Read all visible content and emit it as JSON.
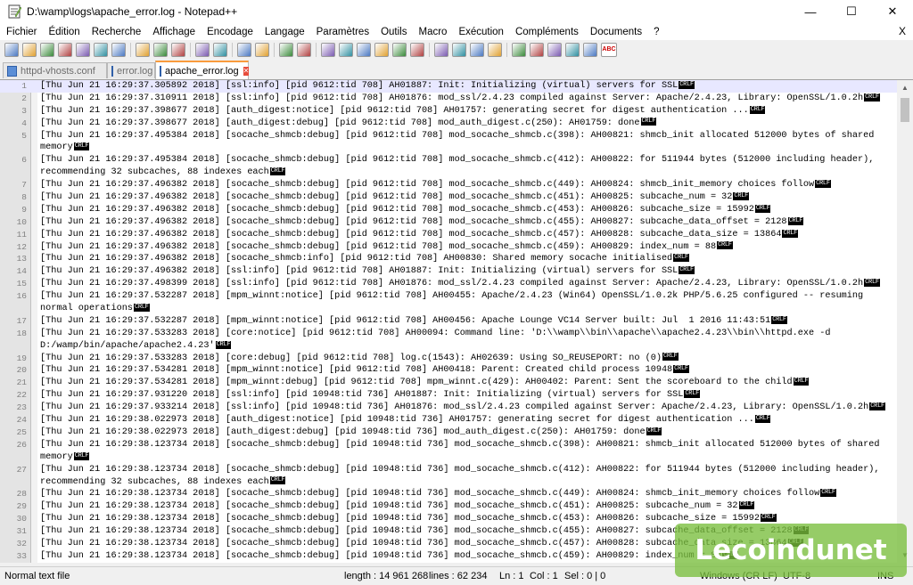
{
  "window": {
    "title": "D:\\wamp\\logs\\apache_error.log - Notepad++",
    "minimize": "—",
    "maximize": "☐",
    "close": "✕"
  },
  "menu": [
    "Fichier",
    "Édition",
    "Recherche",
    "Affichage",
    "Encodage",
    "Langage",
    "Paramètres",
    "Outils",
    "Macro",
    "Exécution",
    "Compléments",
    "Documents",
    "?"
  ],
  "menu_close": "X",
  "toolbar_icons": [
    "new-file-icon",
    "open-file-icon",
    "save-icon",
    "save-all-icon",
    "close-icon",
    "close-all-icon",
    "print-icon",
    "cut-icon",
    "copy-icon",
    "paste-icon",
    "undo-icon",
    "redo-icon",
    "find-icon",
    "replace-icon",
    "zoom-in-icon",
    "zoom-out-icon",
    "sync-vertical-icon",
    "sync-horizontal-icon",
    "word-wrap-icon",
    "show-all-chars-icon",
    "indent-guide-icon",
    "language-icon",
    "doc-map-icon",
    "function-list-icon",
    "folder-workspace-icon",
    "monitoring-icon",
    "record-macro-icon",
    "stop-record-icon",
    "play-macro-icon",
    "run-macro-multiple-icon",
    "save-macro-icon",
    "spell-check-icon"
  ],
  "tabs": [
    {
      "label": "httpd-vhosts.conf",
      "active": false
    },
    {
      "label": "error.log",
      "active": false
    },
    {
      "label": "apache_error.log",
      "active": true
    }
  ],
  "lines": [
    {
      "n": "1",
      "text": "[Thu Jun 21 16:29:37.305892 2018] [ssl:info] [pid 9612:tid 708] AH01887: Init: Initializing (virtual) servers for SSL",
      "crlf": true
    },
    {
      "n": "2",
      "text": "[Thu Jun 21 16:29:37.310911 2018] [ssl:info] [pid 9612:tid 708] AH01876: mod_ssl/2.4.23 compiled against Server: Apache/2.4.23, Library: OpenSSL/1.0.2h",
      "crlf": true
    },
    {
      "n": "3",
      "text": "[Thu Jun 21 16:29:37.398677 2018] [auth_digest:notice] [pid 9612:tid 708] AH01757: generating secret for digest authentication ...",
      "crlf": true
    },
    {
      "n": "4",
      "text": "[Thu Jun 21 16:29:37.398677 2018] [auth_digest:debug] [pid 9612:tid 708] mod_auth_digest.c(250): AH01759: done",
      "crlf": true
    },
    {
      "n": "5",
      "text": "[Thu Jun 21 16:29:37.495384 2018] [socache_shmcb:debug] [pid 9612:tid 708] mod_socache_shmcb.c(398): AH00821: shmcb_init allocated 512000 bytes of shared",
      "crlf": false
    },
    {
      "n": "",
      "text": "memory",
      "crlf": true
    },
    {
      "n": "6",
      "text": "[Thu Jun 21 16:29:37.495384 2018] [socache_shmcb:debug] [pid 9612:tid 708] mod_socache_shmcb.c(412): AH00822: for 511944 bytes (512000 including header),",
      "crlf": false
    },
    {
      "n": "",
      "text": "recommending 32 subcaches, 88 indexes each",
      "crlf": true
    },
    {
      "n": "7",
      "text": "[Thu Jun 21 16:29:37.496382 2018] [socache_shmcb:debug] [pid 9612:tid 708] mod_socache_shmcb.c(449): AH00824: shmcb_init_memory choices follow",
      "crlf": true
    },
    {
      "n": "8",
      "text": "[Thu Jun 21 16:29:37.496382 2018] [socache_shmcb:debug] [pid 9612:tid 708] mod_socache_shmcb.c(451): AH00825: subcache_num = 32",
      "crlf": true
    },
    {
      "n": "9",
      "text": "[Thu Jun 21 16:29:37.496382 2018] [socache_shmcb:debug] [pid 9612:tid 708] mod_socache_shmcb.c(453): AH00826: subcache_size = 15992",
      "crlf": true
    },
    {
      "n": "10",
      "text": "[Thu Jun 21 16:29:37.496382 2018] [socache_shmcb:debug] [pid 9612:tid 708] mod_socache_shmcb.c(455): AH00827: subcache_data_offset = 2128",
      "crlf": true
    },
    {
      "n": "11",
      "text": "[Thu Jun 21 16:29:37.496382 2018] [socache_shmcb:debug] [pid 9612:tid 708] mod_socache_shmcb.c(457): AH00828: subcache_data_size = 13864",
      "crlf": true
    },
    {
      "n": "12",
      "text": "[Thu Jun 21 16:29:37.496382 2018] [socache_shmcb:debug] [pid 9612:tid 708] mod_socache_shmcb.c(459): AH00829: index_num = 88",
      "crlf": true
    },
    {
      "n": "13",
      "text": "[Thu Jun 21 16:29:37.496382 2018] [socache_shmcb:info] [pid 9612:tid 708] AH00830: Shared memory socache initialised",
      "crlf": true
    },
    {
      "n": "14",
      "text": "[Thu Jun 21 16:29:37.496382 2018] [ssl:info] [pid 9612:tid 708] AH01887: Init: Initializing (virtual) servers for SSL",
      "crlf": true
    },
    {
      "n": "15",
      "text": "[Thu Jun 21 16:29:37.498399 2018] [ssl:info] [pid 9612:tid 708] AH01876: mod_ssl/2.4.23 compiled against Server: Apache/2.4.23, Library: OpenSSL/1.0.2h",
      "crlf": true
    },
    {
      "n": "16",
      "text": "[Thu Jun 21 16:29:37.532287 2018] [mpm_winnt:notice] [pid 9612:tid 708] AH00455: Apache/2.4.23 (Win64) OpenSSL/1.0.2k PHP/5.6.25 configured -- resuming",
      "crlf": false
    },
    {
      "n": "",
      "text": "normal operations",
      "crlf": true
    },
    {
      "n": "17",
      "text": "[Thu Jun 21 16:29:37.532287 2018] [mpm_winnt:notice] [pid 9612:tid 708] AH00456: Apache Lounge VC14 Server built: Jul  1 2016 11:43:51",
      "crlf": true
    },
    {
      "n": "18",
      "text": "[Thu Jun 21 16:29:37.533283 2018] [core:notice] [pid 9612:tid 708] AH00094: Command line: 'D:\\\\wamp\\\\bin\\\\apache\\\\apache2.4.23\\\\bin\\\\httpd.exe -d",
      "crlf": false
    },
    {
      "n": "",
      "text": "D:/wamp/bin/apache/apache2.4.23'",
      "crlf": true
    },
    {
      "n": "19",
      "text": "[Thu Jun 21 16:29:37.533283 2018] [core:debug] [pid 9612:tid 708] log.c(1543): AH02639: Using SO_REUSEPORT: no (0)",
      "crlf": true
    },
    {
      "n": "20",
      "text": "[Thu Jun 21 16:29:37.534281 2018] [mpm_winnt:notice] [pid 9612:tid 708] AH00418: Parent: Created child process 10948",
      "crlf": true
    },
    {
      "n": "21",
      "text": "[Thu Jun 21 16:29:37.534281 2018] [mpm_winnt:debug] [pid 9612:tid 708] mpm_winnt.c(429): AH00402: Parent: Sent the scoreboard to the child",
      "crlf": true
    },
    {
      "n": "22",
      "text": "[Thu Jun 21 16:29:37.931220 2018] [ssl:info] [pid 10948:tid 736] AH01887: Init: Initializing (virtual) servers for SSL",
      "crlf": true
    },
    {
      "n": "23",
      "text": "[Thu Jun 21 16:29:37.933214 2018] [ssl:info] [pid 10948:tid 736] AH01876: mod_ssl/2.4.23 compiled against Server: Apache/2.4.23, Library: OpenSSL/1.0.2h",
      "crlf": true
    },
    {
      "n": "24",
      "text": "[Thu Jun 21 16:29:38.022973 2018] [auth_digest:notice] [pid 10948:tid 736] AH01757: generating secret for digest authentication ...",
      "crlf": true
    },
    {
      "n": "25",
      "text": "[Thu Jun 21 16:29:38.022973 2018] [auth_digest:debug] [pid 10948:tid 736] mod_auth_digest.c(250): AH01759: done",
      "crlf": true
    },
    {
      "n": "26",
      "text": "[Thu Jun 21 16:29:38.123734 2018] [socache_shmcb:debug] [pid 10948:tid 736] mod_socache_shmcb.c(398): AH00821: shmcb_init allocated 512000 bytes of shared",
      "crlf": false
    },
    {
      "n": "",
      "text": "memory",
      "crlf": true
    },
    {
      "n": "27",
      "text": "[Thu Jun 21 16:29:38.123734 2018] [socache_shmcb:debug] [pid 10948:tid 736] mod_socache_shmcb.c(412): AH00822: for 511944 bytes (512000 including header),",
      "crlf": false
    },
    {
      "n": "",
      "text": "recommending 32 subcaches, 88 indexes each",
      "crlf": true
    },
    {
      "n": "28",
      "text": "[Thu Jun 21 16:29:38.123734 2018] [socache_shmcb:debug] [pid 10948:tid 736] mod_socache_shmcb.c(449): AH00824: shmcb_init_memory choices follow",
      "crlf": true
    },
    {
      "n": "29",
      "text": "[Thu Jun 21 16:29:38.123734 2018] [socache_shmcb:debug] [pid 10948:tid 736] mod_socache_shmcb.c(451): AH00825: subcache_num = 32",
      "crlf": true
    },
    {
      "n": "30",
      "text": "[Thu Jun 21 16:29:38.123734 2018] [socache_shmcb:debug] [pid 10948:tid 736] mod_socache_shmcb.c(453): AH00826: subcache_size = 15992",
      "crlf": true
    },
    {
      "n": "31",
      "text": "[Thu Jun 21 16:29:38.123734 2018] [socache_shmcb:debug] [pid 10948:tid 736] mod_socache_shmcb.c(455): AH00827: subcache_data_offset = 2128",
      "crlf": true
    },
    {
      "n": "32",
      "text": "[Thu Jun 21 16:29:38.123734 2018] [socache_shmcb:debug] [pid 10948:tid 736] mod_socache_shmcb.c(457): AH00828: subcache_data_size = 13864",
      "crlf": true
    },
    {
      "n": "33",
      "text": "[Thu Jun 21 16:29:38.123734 2018] [socache_shmcb:debug] [pid 10948:tid 736] mod_socache_shmcb.c(459): AH00829: index_num = 88",
      "crlf": true
    }
  ],
  "crlf_label": "CRLF",
  "status": {
    "file_type": "Normal text file",
    "length": "length : 14 961 268",
    "lines": "lines : 62 234",
    "ln": "Ln : 1",
    "col": "Col : 1",
    "sel": "Sel : 0 | 0",
    "eol": "Windows (CR LF)",
    "encoding": "UTF-8",
    "mode": "INS"
  },
  "watermark": "Lecoindunet",
  "colors": {
    "tab_accent": "#fa9b3c",
    "current_line": "#e8e8ff",
    "watermark": "#78be3c"
  }
}
